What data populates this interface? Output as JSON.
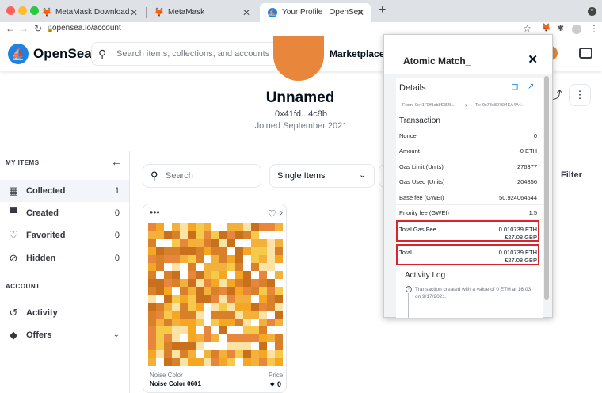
{
  "browser": {
    "tabs": [
      {
        "title": "MetaMask Download",
        "active": false
      },
      {
        "title": "MetaMask",
        "active": false
      },
      {
        "title": "Your Profile | OpenSea",
        "active": true
      }
    ],
    "url": "opensea.io/account"
  },
  "header": {
    "brand": "OpenSea",
    "search_placeholder": "Search items, collections, and accounts",
    "nav_marketplace": "Marketplace"
  },
  "profile": {
    "name": "Unnamed",
    "address": "0x41fd...4c8b",
    "joined": "Joined September 2021"
  },
  "sidebar": {
    "my_items_title": "MY ITEMS",
    "items": [
      {
        "label": "Collected",
        "count": "1",
        "icon": "grid-icon"
      },
      {
        "label": "Created",
        "count": "0",
        "icon": "paint-roller-icon"
      },
      {
        "label": "Favorited",
        "count": "0",
        "icon": "heart-icon"
      },
      {
        "label": "Hidden",
        "count": "0",
        "icon": "eye-off-icon"
      }
    ],
    "account_title": "ACCOUNT",
    "account_items": [
      {
        "label": "Activity",
        "icon": "history-icon"
      },
      {
        "label": "Offers",
        "icon": "tag-icon"
      }
    ]
  },
  "filters": {
    "search_placeholder": "Search",
    "select_value": "Single Items",
    "filter_label": "Filter"
  },
  "card": {
    "favorites": "2",
    "collection": "Noise Color",
    "name": "Noise Color 0601",
    "price_label": "Price",
    "price": "0"
  },
  "metamask": {
    "title": "Atomic Match_",
    "details_label": "Details",
    "from": "From: 0x41FDf1cb8f2828...",
    "to": "To: 0x78e8076f4EA4A4...",
    "transaction_label": "Transaction",
    "rows": [
      {
        "k": "Nonce",
        "v": "0"
      },
      {
        "k": "Amount",
        "v": "-0 ETH"
      },
      {
        "k": "Gas Limit (Units)",
        "v": "276377"
      },
      {
        "k": "Gas Used (Units)",
        "v": "204856"
      },
      {
        "k": "Base fee (GWEI)",
        "v": "50.924064544"
      },
      {
        "k": "Priority fee (GWEI)",
        "v": "1.5"
      }
    ],
    "total_gas_fee": {
      "k": "Total Gas Fee",
      "eth": "0.010739  ETH",
      "gbp": "£27.08 GBP"
    },
    "total": {
      "k": "Total",
      "eth": "0.010739  ETH",
      "gbp": "£27.08 GBP"
    },
    "activity_label": "Activity Log",
    "activity_text": "Transaction created with a value of 0 ETH at 16:03 on 9/17/2021."
  },
  "colors": {
    "accent": "#2081e2",
    "highlight": "#d8242c",
    "nft_palette": [
      "#f5a623",
      "#e8863b",
      "#f7c94a",
      "#d9812a",
      "#fbe3a6",
      "#ffffff",
      "#c9701c",
      "#f3b03b"
    ]
  }
}
